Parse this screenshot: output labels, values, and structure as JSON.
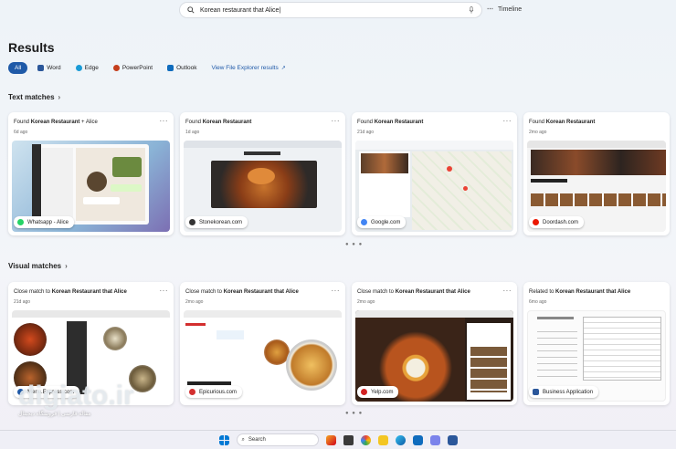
{
  "search": {
    "query": "Korean restaurant that Alice|"
  },
  "timeline": {
    "label": "Timeline"
  },
  "page_title": "Results",
  "filters": [
    {
      "label": "All",
      "color": "#1f5aa8"
    },
    {
      "label": "Word",
      "color": "#2b579a"
    },
    {
      "label": "Edge",
      "color": "#1a9bd6"
    },
    {
      "label": "PowerPoint",
      "color": "#c43e1c"
    },
    {
      "label": "Outlook",
      "color": "#0f6cbd"
    },
    {
      "label": "View File Explorer results",
      "color": "#1f5aa8"
    }
  ],
  "text_matches": {
    "heading": "Text matches",
    "cards": [
      {
        "prefix": "Found ",
        "bold": "Korean Restaurant",
        "suffix": " + Alice",
        "date": "6d ago",
        "source": "Whatsapp - Alice",
        "source_color": "#25d366"
      },
      {
        "prefix": "Found ",
        "bold": "Korean Restaurant",
        "suffix": "",
        "date": "1d ago",
        "source": "Stonekorean.com",
        "source_color": "#333333"
      },
      {
        "prefix": "Found ",
        "bold": "Korean Restaurant",
        "suffix": "",
        "date": "21d ago",
        "source": "Google.com",
        "source_color": "#4285f4"
      },
      {
        "prefix": "Found ",
        "bold": "Korean Restaurant",
        "suffix": "",
        "date": "2mo ago",
        "source": "Doordash.com",
        "source_color": "#eb1700"
      }
    ]
  },
  "visual_matches": {
    "heading": "Visual matches",
    "cards": [
      {
        "prefix": "Close match to ",
        "bold": "Korean Restaurant that Alice",
        "date": "21d ago",
        "source": "Menu.Express.com",
        "source_color": "#1f5aa8"
      },
      {
        "prefix": "Close match to ",
        "bold": "Korean Restaurant that Alice",
        "date": "2mo ago",
        "source": "Epicurious.com",
        "source_color": "#d32f2f"
      },
      {
        "prefix": "Close match to ",
        "bold": "Korean Restaurant that Alice",
        "date": "2mo ago",
        "source": "Yelp.com",
        "source_color": "#d32323"
      },
      {
        "prefix": "Related to ",
        "bold": "Korean Restaurant that Alice",
        "date": "6mo ago",
        "source": "Business Application",
        "source_color": "#2b579a"
      }
    ]
  },
  "taskbar": {
    "search_label": "Search"
  },
  "watermark": {
    "brand": "digiato.ir",
    "tagline": "مقاله فارسی | فروشگاه دیجیتال"
  }
}
